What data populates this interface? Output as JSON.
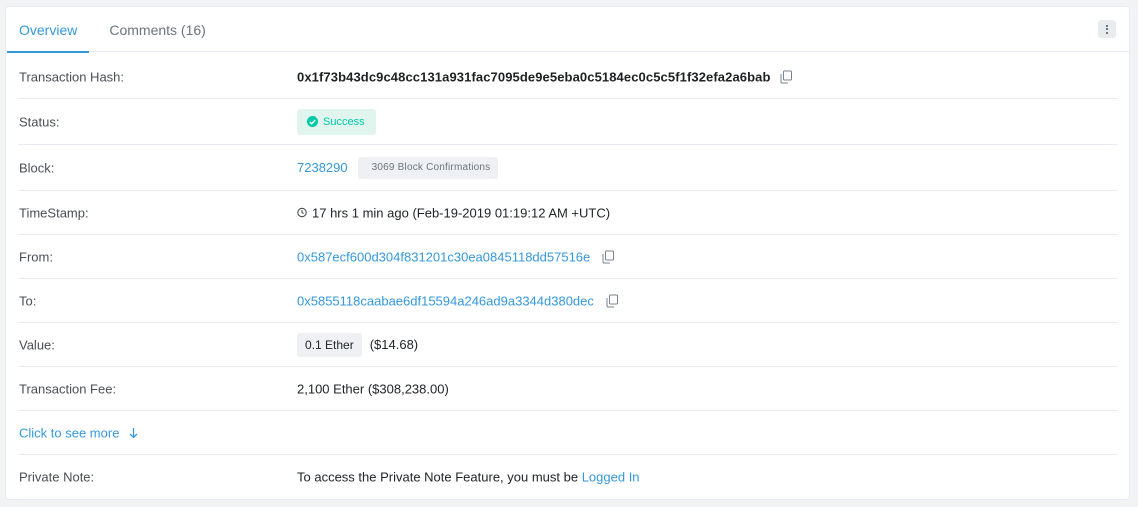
{
  "tabs": [
    {
      "label": "Overview",
      "active": true
    },
    {
      "label": "Comments (16)",
      "active": false
    }
  ],
  "colors": {
    "accent": "#3498db",
    "success": "#00c9a7"
  },
  "rows": {
    "tx_hash": {
      "label": "Transaction Hash:",
      "value": "0x1f73b43dc9c48cc131a931fac7095de9e5eba0c5184ec0c5c5f1f32efa2a6bab"
    },
    "status": {
      "label": "Status:",
      "value": "Success"
    },
    "block": {
      "label": "Block:",
      "number": "7238290",
      "confirmations": "3069 Block Confirmations"
    },
    "timestamp": {
      "label": "TimeStamp:",
      "value": "17 hrs 1 min ago (Feb-19-2019 01:19:12 AM +UTC)"
    },
    "from": {
      "label": "From:",
      "value": "0x587ecf600d304f831201c30ea0845118dd57516e"
    },
    "to": {
      "label": "To:",
      "value": "0x5855118caabae6df15594a246ad9a3344d380dec"
    },
    "value": {
      "label": "Value:",
      "amount": "0.1 Ether",
      "usd": "($14.68)"
    },
    "fee": {
      "label": "Transaction Fee:",
      "value": "2,100 Ether ($308,238.00)"
    },
    "see_more": {
      "label": "Click to see more"
    },
    "private_note": {
      "label": "Private Note:",
      "text": "To access the Private Note Feature, you must be ",
      "link": "Logged In"
    }
  },
  "icons": [
    "more-vertical-icon",
    "copy-icon",
    "check-circle-icon",
    "clock-icon",
    "arrow-down-icon"
  ]
}
